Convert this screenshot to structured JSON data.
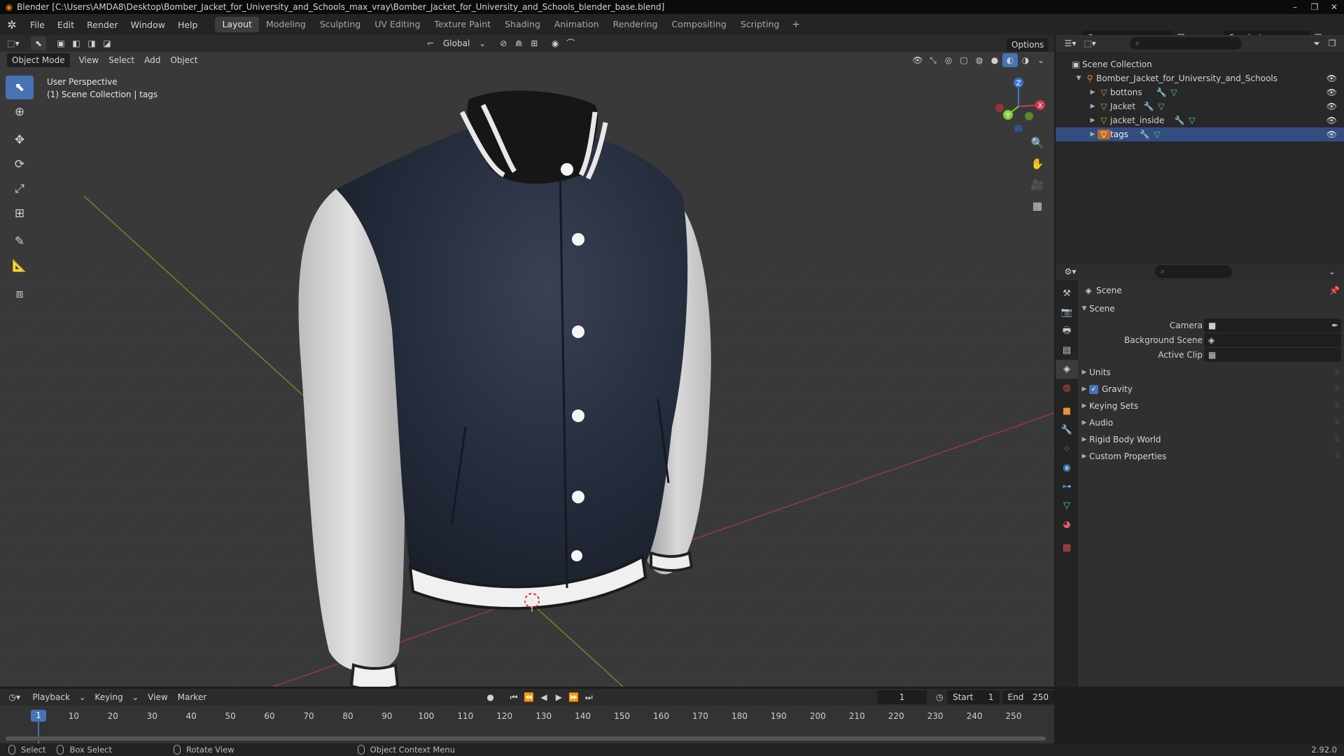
{
  "window": {
    "title": "Blender [C:\\Users\\AMDA8\\Desktop\\Bomber_Jacket_for_University_and_Schools_max_vray\\Bomber_Jacket_for_University_and_Schools_blender_base.blend]",
    "controls": [
      "–",
      "❐",
      "✕"
    ]
  },
  "menu": {
    "items": [
      "File",
      "Edit",
      "Render",
      "Window",
      "Help"
    ],
    "workspaces": [
      "Layout",
      "Modeling",
      "Sculpting",
      "UV Editing",
      "Texture Paint",
      "Shading",
      "Animation",
      "Rendering",
      "Compositing",
      "Scripting"
    ],
    "active_workspace": "Layout",
    "add_workspace": "+",
    "scene": "Scene",
    "view_layer": "RenderLayer"
  },
  "viewport": {
    "mode": "Object Mode",
    "menus": [
      "View",
      "Select",
      "Add",
      "Object"
    ],
    "transform_orientation": "Global",
    "options_label": "Options",
    "info_line1": "User Perspective",
    "info_line2": "(1) Scene Collection | tags",
    "gizmo_axes": [
      "X",
      "Y",
      "Z"
    ]
  },
  "outliner": {
    "root": "Scene Collection",
    "collection": "Bomber_Jacket_for_University_and_Schools",
    "objects": [
      {
        "name": "bottons"
      },
      {
        "name": "Jacket"
      },
      {
        "name": "jacket_inside"
      },
      {
        "name": "tags"
      }
    ]
  },
  "properties": {
    "context_label": "Scene",
    "panel_title": "Scene",
    "fields": [
      {
        "label": "Camera",
        "value": ""
      },
      {
        "label": "Background Scene",
        "value": ""
      },
      {
        "label": "Active Clip",
        "value": ""
      }
    ],
    "subpanels": [
      "Units",
      "Gravity",
      "Keying Sets",
      "Audio",
      "Rigid Body World",
      "Custom Properties"
    ],
    "gravity_checked": true
  },
  "timeline": {
    "menus": [
      "Playback",
      "Keying",
      "View",
      "Marker"
    ],
    "current_frame": "1",
    "start_label": "Start",
    "start": "1",
    "end_label": "End",
    "end": "250",
    "ticks": [
      "10",
      "20",
      "30",
      "40",
      "50",
      "60",
      "70",
      "80",
      "90",
      "100",
      "110",
      "120",
      "130",
      "140",
      "150",
      "160",
      "170",
      "180",
      "190",
      "200",
      "210",
      "220",
      "230",
      "240",
      "250"
    ],
    "marker_frame": "1"
  },
  "statusbar": {
    "select": "Select",
    "box_select": "Box Select",
    "rotate_view": "Rotate View",
    "context_menu": "Object Context Menu",
    "version": "2.92.0"
  },
  "colors": {
    "accent": "#4772b3",
    "object_orange": "#e8923a",
    "mesh_green": "#47d18f",
    "jacket_navy": "#252c3c",
    "sleeve_white": "#dcdcdc"
  }
}
